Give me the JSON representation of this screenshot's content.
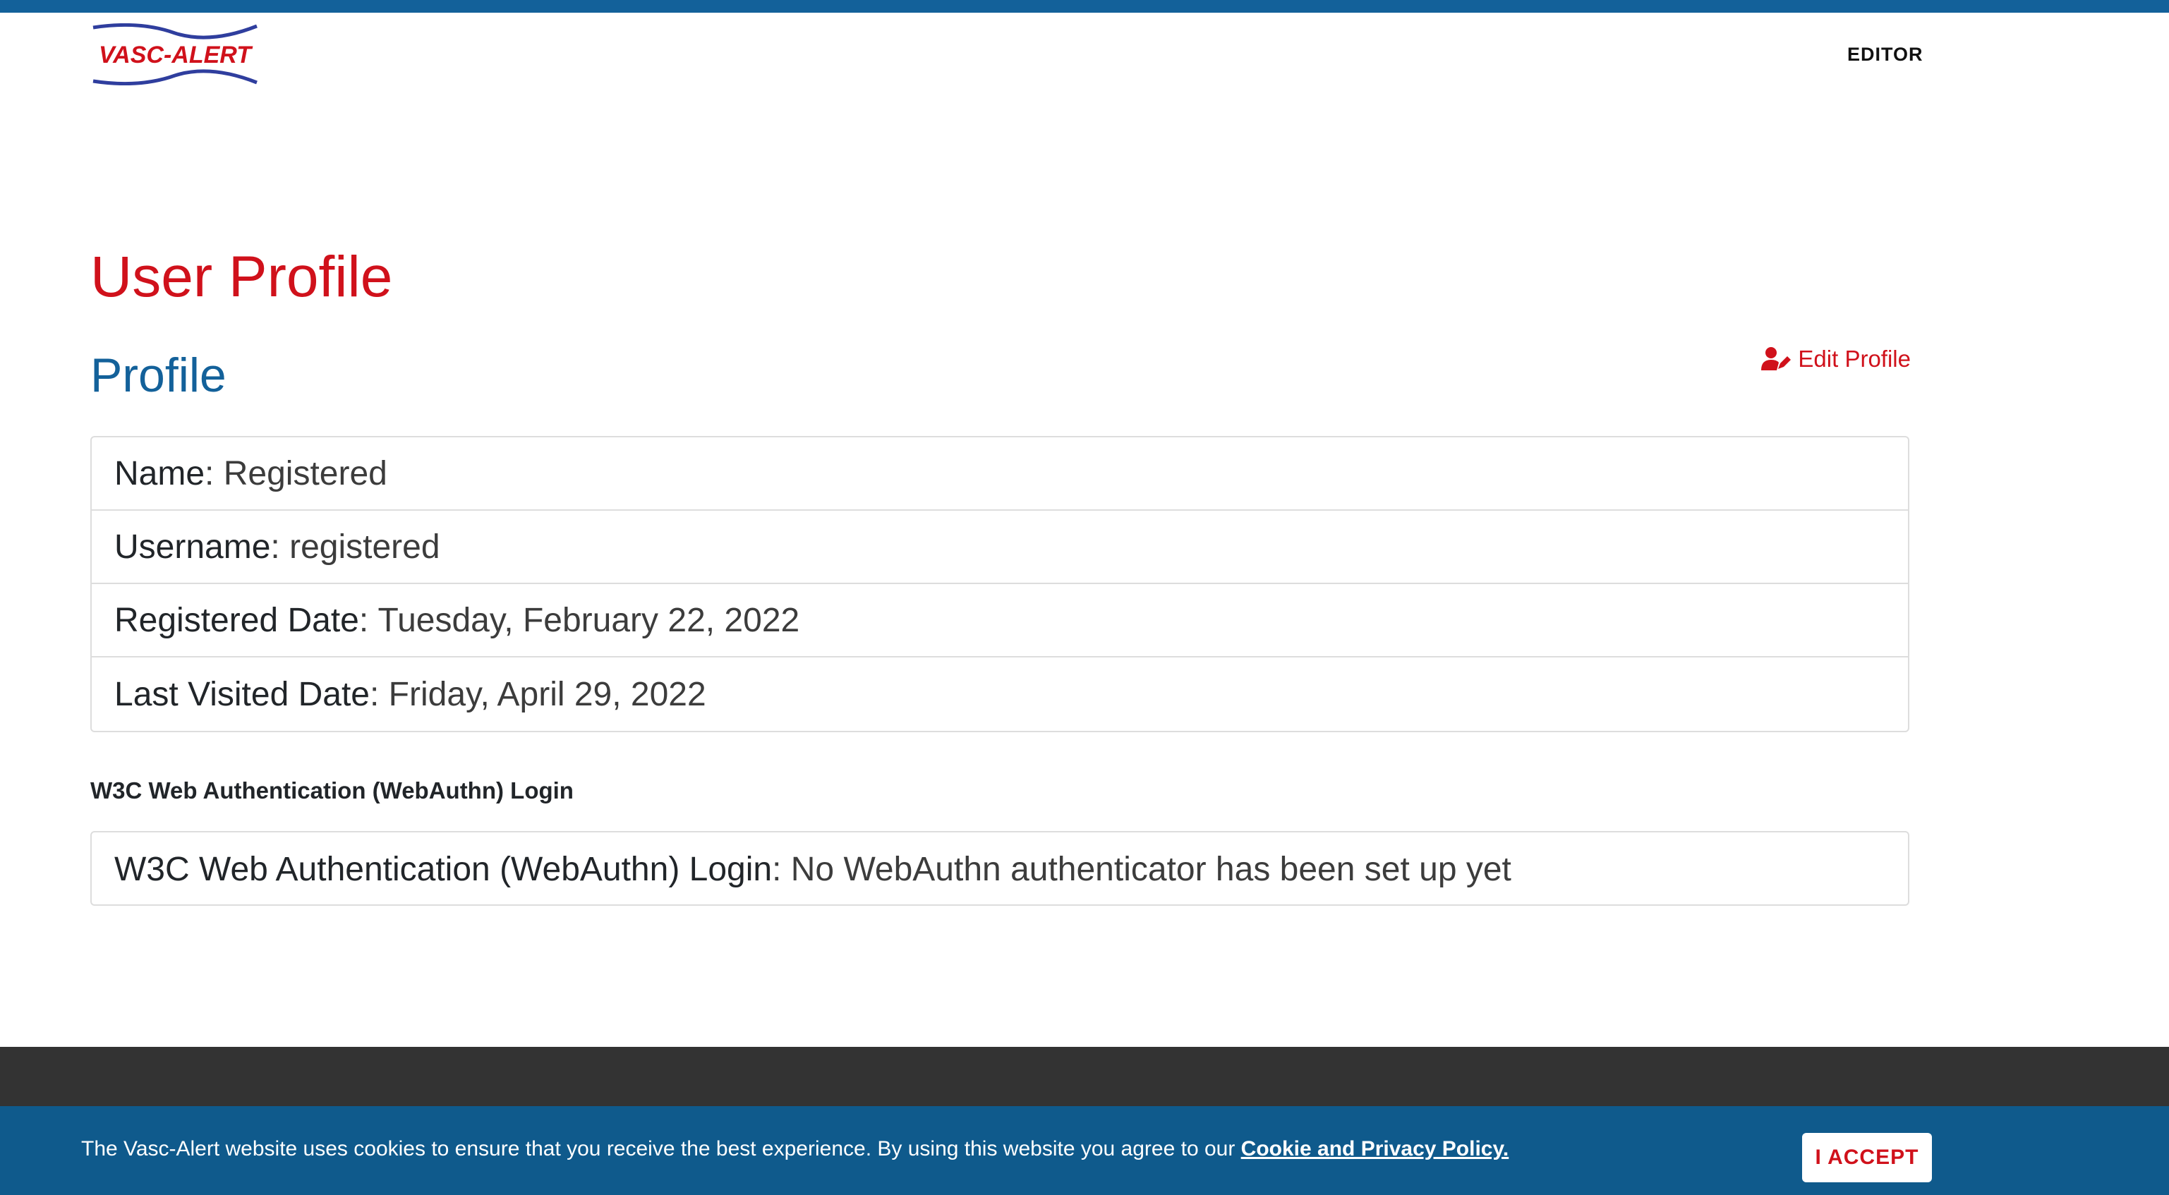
{
  "header": {
    "logo_text": "VASC-ALERT",
    "nav_editor": "EDITOR"
  },
  "page": {
    "title": "User Profile",
    "section_title": "Profile",
    "edit_profile_label": "Edit Profile"
  },
  "profile": {
    "rows": [
      {
        "label": "Name",
        "value": "Registered"
      },
      {
        "label": "Username",
        "value": "registered"
      },
      {
        "label": "Registered Date",
        "value": "Tuesday, February 22, 2022"
      },
      {
        "label": "Last Visited Date",
        "value": "Friday, April 29, 2022"
      }
    ]
  },
  "webauthn": {
    "heading": "W3C Web Authentication (WebAuthn) Login",
    "row": {
      "label": "W3C Web Authentication (WebAuthn) Login",
      "value": "No WebAuthn authenticator has been set up yet"
    }
  },
  "cookie_banner": {
    "text": "The Vasc-Alert website uses cookies to ensure that you receive the best experience. By using this website you agree to our ",
    "link_text": "Cookie and Privacy Policy.",
    "accept_label": "I ACCEPT"
  },
  "colors": {
    "brand_blue": "#13619a",
    "brand_red": "#d0111b",
    "footer_dark": "#333333",
    "cookie_banner_bg": "#0f5a8c"
  },
  "icons": {
    "edit_profile": "user-edit-icon"
  }
}
